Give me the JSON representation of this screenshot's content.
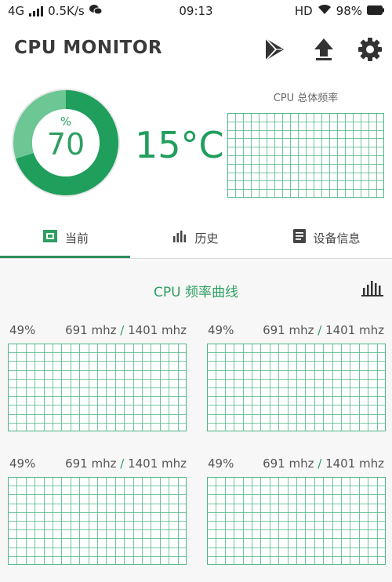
{
  "status_bar": {
    "network": "4G",
    "speed": "0.5K/s",
    "time": "09:13",
    "hd": "HD",
    "battery": "98%"
  },
  "app": {
    "title": "CPU MONITOR"
  },
  "gauge": {
    "unit": "%",
    "value": "70",
    "fraction": 0.7
  },
  "temperature": "15°C",
  "total_freq_label": "CPU 总体频率",
  "tabs": [
    {
      "label": "当前"
    },
    {
      "label": "历史"
    },
    {
      "label": "设备信息"
    }
  ],
  "section_title": "CPU 频率曲线",
  "cores": [
    {
      "usage": "49%",
      "current": "691 mhz",
      "max": "1401 mhz"
    },
    {
      "usage": "49%",
      "current": "691 mhz",
      "max": "1401 mhz"
    },
    {
      "usage": "49%",
      "current": "691 mhz",
      "max": "1401 mhz"
    },
    {
      "usage": "49%",
      "current": "691 mhz",
      "max": "1401 mhz"
    }
  ],
  "colors": {
    "accent": "#2e9e61",
    "gauge_dark": "#1f9e5c",
    "gauge_light": "#6cc794",
    "grid_line": "#4fb583"
  }
}
